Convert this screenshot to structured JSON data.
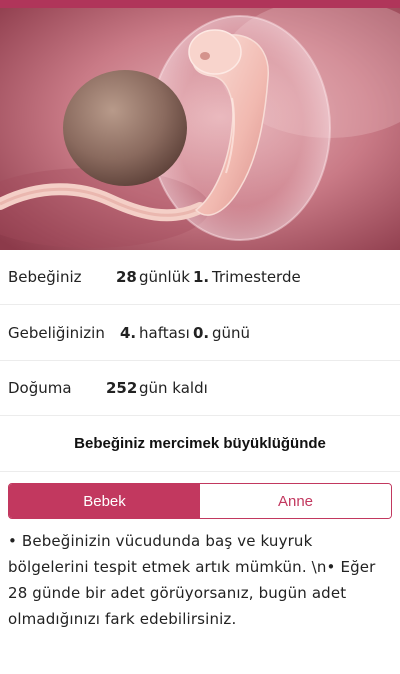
{
  "colors": {
    "accent": "#c2385f",
    "topbar": "#b0355a"
  },
  "hero": {
    "image_name": "embryo-image"
  },
  "info": {
    "row1": {
      "label": "Bebeğiniz",
      "days": "28",
      "days_unit": "günlük",
      "trimester": "1.",
      "trimester_label": "Trimesterde"
    },
    "row2": {
      "label": "Gebeliğinizin",
      "week": "4.",
      "week_label": "haftası",
      "day": "0.",
      "day_label": "günü"
    },
    "row3": {
      "label": "Doğuma",
      "days_left": "252",
      "days_left_label": "gün kaldı"
    }
  },
  "size_banner": "Bebeğiniz mercimek büyüklüğünde",
  "tabs": {
    "baby": "Bebek",
    "mother": "Anne",
    "selected": "Bebek"
  },
  "description": "• Bebeğinizin vücudunda baş ve kuyruk bölgelerini tespit etmek artık mümkün. \\n• Eğer 28 günde bir adet görüyorsanız, bugün adet olmadığınızı fark edebilirsiniz."
}
